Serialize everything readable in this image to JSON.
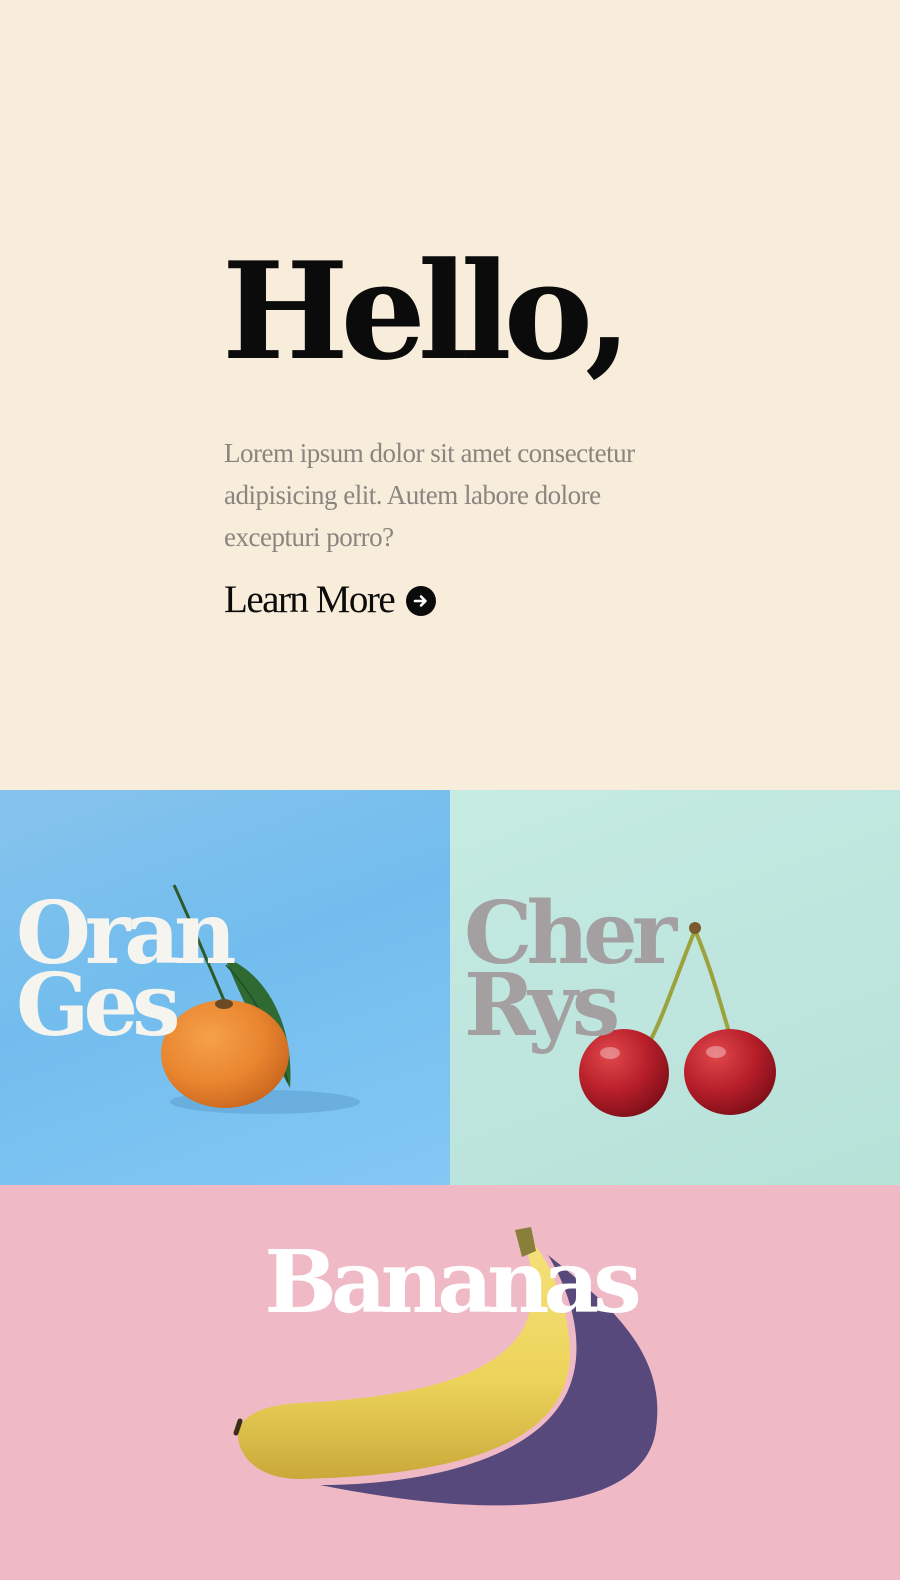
{
  "hero": {
    "title": "Hello,",
    "body": "Lorem ipsum dolor sit amet consectetur adipisicing elit. Autem labore dolore excepturi porro?",
    "cta_label": "Learn More",
    "cta_icon": "arrow-right-circle-icon"
  },
  "tiles": {
    "oranges": {
      "line1": "Oran",
      "line2": "Ges",
      "image": "orange-image"
    },
    "cherries": {
      "line1": "Cher",
      "line2": "Rys",
      "image": "cherries-image"
    },
    "bananas": {
      "label": "Bananas",
      "image": "banana-image"
    }
  },
  "colors": {
    "hero_bg": "#f8ecdb",
    "oranges_bg": "#7cc1ee",
    "cherries_bg": "#bfe7de",
    "bananas_bg": "#efbac6",
    "title_text": "#0b0b0b",
    "body_text": "#8a857e"
  }
}
